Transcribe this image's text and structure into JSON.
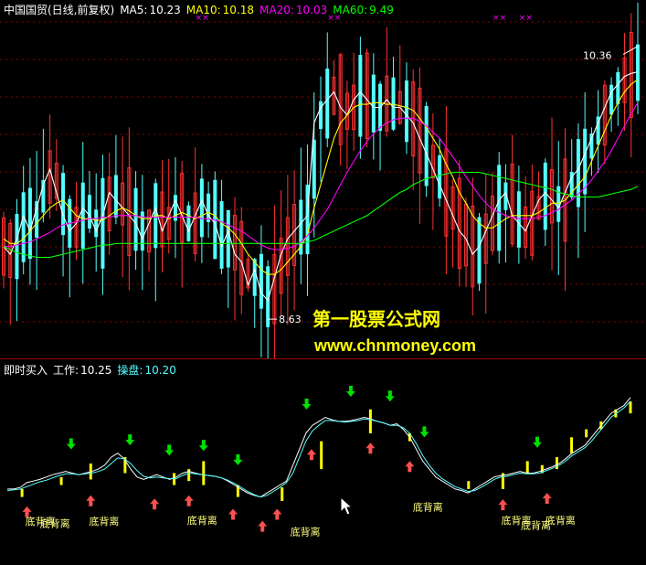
{
  "header": {
    "stock_name": "中国国贸(日线,前复权)",
    "ma5_label": "MA5:",
    "ma5_value": "10.23",
    "ma10_label": "MA10:",
    "ma10_value": "10.18",
    "ma20_label": "MA20:",
    "ma20_value": "10.03",
    "ma60_label": "MA60:",
    "ma60_value": "9.49"
  },
  "sub_header": {
    "indicator_name": "即时买入",
    "work_label": "工作:",
    "work_value": "10.25",
    "trade_label": "操盘:",
    "trade_value": "10.20"
  },
  "watermark": {
    "line1": "第一股票公式网",
    "line2": "www.chnmoney.com"
  },
  "colors": {
    "up": "#ff3232",
    "down": "#54ffff",
    "ma5": "#ffffff",
    "ma10": "#ffff00",
    "ma20": "#ff00ff",
    "ma60": "#00ff00",
    "grid": "#8b0000",
    "work": "#ffffff",
    "trade": "#54ffff",
    "bar": "#ffff00",
    "buy_arrow": "#ff5050",
    "sell_arrow": "#00e000"
  },
  "chart_data": [
    {
      "type": "candlestick",
      "title": "中国国贸(日线,前复权)",
      "ylim": [
        8.4,
        10.6
      ],
      "annotations": [
        {
          "text": "10.36",
          "kind": "high",
          "x": 96,
          "y": 10.36
        },
        {
          "text": "8.63",
          "kind": "low",
          "x": 40,
          "y": 8.63
        }
      ],
      "top_markers": {
        "text": "××",
        "x": [
          29,
          49,
          74,
          78
        ]
      },
      "series": [
        {
          "name": "MA5",
          "values": [
            9.1,
            9.05,
            9.15,
            9.3,
            9.2,
            9.35,
            9.5,
            9.6,
            9.45,
            9.3,
            9.2,
            9.25,
            9.35,
            9.3,
            9.2,
            9.3,
            9.45,
            9.4,
            9.35,
            9.3,
            9.25,
            9.15,
            9.25,
            9.35,
            9.2,
            9.3,
            9.4,
            9.3,
            9.2,
            9.3,
            9.4,
            9.3,
            9.25,
            9.1,
            9.2,
            9.05,
            9.0,
            8.85,
            8.95,
            8.8,
            8.75,
            8.9,
            9.05,
            9.15,
            9.2,
            9.25,
            9.3,
            9.9,
            10.0,
            10.05,
            10.1,
            10.0,
            9.95,
            10.05,
            10.1,
            10.05,
            10.0,
            10.0,
            10.05,
            10.0,
            10.0,
            9.95,
            9.9,
            9.8,
            9.7,
            9.6,
            9.5,
            9.4,
            9.3,
            9.2,
            9.15,
            9.05,
            9.1,
            9.2,
            9.3,
            9.4,
            9.45,
            9.3,
            9.25,
            9.2,
            9.3,
            9.4,
            9.45,
            9.4,
            9.35,
            9.45,
            9.55,
            9.6,
            9.7,
            9.8,
            9.9,
            10.0,
            10.1,
            10.15,
            10.2,
            10.22,
            10.23
          ]
        },
        {
          "name": "MA10",
          "values": [
            9.15,
            9.12,
            9.12,
            9.15,
            9.2,
            9.25,
            9.3,
            9.35,
            9.38,
            9.4,
            9.35,
            9.3,
            9.28,
            9.28,
            9.27,
            9.27,
            9.3,
            9.33,
            9.35,
            9.33,
            9.3,
            9.28,
            9.28,
            9.3,
            9.3,
            9.28,
            9.3,
            9.32,
            9.3,
            9.28,
            9.3,
            9.32,
            9.3,
            9.25,
            9.22,
            9.18,
            9.12,
            9.05,
            9.0,
            8.95,
            8.92,
            8.92,
            8.95,
            9.0,
            9.05,
            9.1,
            9.18,
            9.35,
            9.5,
            9.65,
            9.8,
            9.9,
            9.95,
            10.0,
            10.02,
            10.02,
            10.03,
            10.03,
            10.02,
            10.02,
            10.01,
            10.0,
            9.98,
            9.93,
            9.87,
            9.8,
            9.73,
            9.63,
            9.55,
            9.45,
            9.38,
            9.3,
            9.25,
            9.22,
            9.22,
            9.25,
            9.28,
            9.3,
            9.3,
            9.3,
            9.3,
            9.32,
            9.35,
            9.38,
            9.38,
            9.4,
            9.45,
            9.5,
            9.55,
            9.65,
            9.75,
            9.85,
            9.95,
            10.03,
            10.1,
            10.15,
            10.18
          ]
        },
        {
          "name": "MA20",
          "values": [
            9.1,
            9.1,
            9.11,
            9.12,
            9.13,
            9.15,
            9.17,
            9.19,
            9.22,
            9.24,
            9.25,
            9.26,
            9.27,
            9.28,
            9.28,
            9.29,
            9.29,
            9.3,
            9.3,
            9.3,
            9.3,
            9.29,
            9.29,
            9.29,
            9.29,
            9.29,
            9.29,
            9.29,
            9.29,
            9.29,
            9.28,
            9.28,
            9.27,
            9.26,
            9.24,
            9.22,
            9.2,
            9.17,
            9.14,
            9.11,
            9.09,
            9.08,
            9.08,
            9.09,
            9.1,
            9.13,
            9.17,
            9.22,
            9.28,
            9.34,
            9.42,
            9.5,
            9.58,
            9.65,
            9.72,
            9.78,
            9.83,
            9.87,
            9.9,
            9.92,
            9.93,
            9.93,
            9.93,
            9.91,
            9.88,
            9.84,
            9.8,
            9.74,
            9.68,
            9.62,
            9.55,
            9.49,
            9.43,
            9.38,
            9.34,
            9.32,
            9.3,
            9.29,
            9.28,
            9.28,
            9.28,
            9.29,
            9.3,
            9.32,
            9.34,
            9.37,
            9.4,
            9.44,
            9.48,
            9.53,
            9.59,
            9.65,
            9.72,
            9.8,
            9.88,
            9.96,
            10.03
          ]
        },
        {
          "name": "MA60",
          "values": [
            9.1,
            9.08,
            9.06,
            9.05,
            9.04,
            9.03,
            9.03,
            9.03,
            9.04,
            9.05,
            9.06,
            9.07,
            9.08,
            9.09,
            9.1,
            9.11,
            9.11,
            9.12,
            9.12,
            9.12,
            9.12,
            9.12,
            9.12,
            9.12,
            9.12,
            9.12,
            9.12,
            9.12,
            9.12,
            9.12,
            9.12,
            9.12,
            9.12,
            9.12,
            9.12,
            9.12,
            9.12,
            9.12,
            9.12,
            9.12,
            9.12,
            9.12,
            9.12,
            9.12,
            9.12,
            9.12,
            9.13,
            9.14,
            9.16,
            9.18,
            9.2,
            9.22,
            9.24,
            9.26,
            9.28,
            9.3,
            9.33,
            9.36,
            9.39,
            9.42,
            9.45,
            9.47,
            9.5,
            9.52,
            9.54,
            9.55,
            9.56,
            9.57,
            9.58,
            9.58,
            9.58,
            9.58,
            9.58,
            9.57,
            9.56,
            9.55,
            9.54,
            9.53,
            9.52,
            9.51,
            9.5,
            9.49,
            9.48,
            9.47,
            9.45,
            9.44,
            9.43,
            9.42,
            9.42,
            9.42,
            9.42,
            9.43,
            9.44,
            9.45,
            9.46,
            9.47,
            9.49
          ]
        }
      ]
    },
    {
      "type": "line",
      "title": "即时买入",
      "ylim": [
        8.8,
        10.5
      ],
      "series": [
        {
          "name": "工作",
          "values": [
            9.1,
            9.1,
            9.12,
            9.18,
            9.2,
            9.22,
            9.25,
            9.28,
            9.3,
            9.32,
            9.3,
            9.28,
            9.3,
            9.32,
            9.35,
            9.4,
            9.5,
            9.55,
            9.48,
            9.35,
            9.25,
            9.22,
            9.25,
            9.28,
            9.25,
            9.22,
            9.25,
            9.3,
            9.32,
            9.3,
            9.28,
            9.27,
            9.26,
            9.24,
            9.2,
            9.15,
            9.1,
            9.05,
            9.02,
            9.0,
            9.05,
            9.1,
            9.15,
            9.2,
            9.4,
            9.6,
            9.8,
            9.9,
            9.95,
            10.0,
            9.97,
            9.95,
            9.95,
            9.96,
            9.98,
            10.0,
            9.98,
            9.95,
            9.93,
            9.9,
            9.92,
            9.85,
            9.75,
            9.6,
            9.45,
            9.35,
            9.25,
            9.2,
            9.15,
            9.1,
            9.08,
            9.05,
            9.1,
            9.15,
            9.2,
            9.25,
            9.27,
            9.28,
            9.3,
            9.32,
            9.3,
            9.3,
            9.32,
            9.35,
            9.38,
            9.42,
            9.48,
            9.55,
            9.6,
            9.65,
            9.75,
            9.85,
            9.95,
            10.05,
            10.1,
            10.15,
            10.25
          ]
        },
        {
          "name": "操盘",
          "values": [
            9.08,
            9.09,
            9.1,
            9.13,
            9.16,
            9.19,
            9.21,
            9.24,
            9.27,
            9.29,
            9.29,
            9.28,
            9.29,
            9.3,
            9.32,
            9.35,
            9.42,
            9.49,
            9.48,
            9.42,
            9.33,
            9.26,
            9.24,
            9.25,
            9.24,
            9.23,
            9.23,
            9.27,
            9.3,
            9.29,
            9.28,
            9.27,
            9.26,
            9.24,
            9.21,
            9.17,
            9.12,
            9.07,
            9.03,
            9.0,
            9.02,
            9.07,
            9.12,
            9.18,
            9.3,
            9.5,
            9.7,
            9.83,
            9.9,
            9.96,
            9.96,
            9.95,
            9.94,
            9.95,
            9.96,
            9.98,
            9.97,
            9.95,
            9.93,
            9.9,
            9.9,
            9.87,
            9.8,
            9.67,
            9.52,
            9.4,
            9.3,
            9.23,
            9.18,
            9.13,
            9.1,
            9.07,
            9.08,
            9.12,
            9.17,
            9.22,
            9.25,
            9.26,
            9.28,
            9.3,
            9.29,
            9.29,
            9.3,
            9.33,
            9.36,
            9.4,
            9.45,
            9.52,
            9.57,
            9.62,
            9.7,
            9.8,
            9.9,
            10.0,
            10.06,
            10.12,
            10.2
          ]
        }
      ],
      "signal_bars": [
        {
          "x": 3,
          "from": 9.0,
          "to": 9.1
        },
        {
          "x": 11,
          "from": 9.15,
          "to": 9.25
        },
        {
          "x": 17,
          "from": 9.22,
          "to": 9.42
        },
        {
          "x": 24,
          "from": 9.3,
          "to": 9.5
        },
        {
          "x": 34,
          "from": 9.15,
          "to": 9.3
        },
        {
          "x": 37,
          "from": 9.2,
          "to": 9.35
        },
        {
          "x": 40,
          "from": 9.15,
          "to": 9.45
        },
        {
          "x": 47,
          "from": 9.0,
          "to": 9.15
        },
        {
          "x": 56,
          "from": 8.95,
          "to": 9.12
        },
        {
          "x": 64,
          "from": 9.35,
          "to": 9.7
        },
        {
          "x": 74,
          "from": 9.8,
          "to": 10.1
        },
        {
          "x": 82,
          "from": 9.7,
          "to": 9.8
        },
        {
          "x": 94,
          "from": 9.1,
          "to": 9.2
        },
        {
          "x": 101,
          "from": 9.1,
          "to": 9.3
        },
        {
          "x": 106,
          "from": 9.3,
          "to": 9.45
        },
        {
          "x": 109,
          "from": 9.3,
          "to": 9.4
        },
        {
          "x": 112,
          "from": 9.35,
          "to": 9.5
        },
        {
          "x": 115,
          "from": 9.55,
          "to": 9.75
        },
        {
          "x": 118,
          "from": 9.75,
          "to": 9.85
        },
        {
          "x": 121,
          "from": 9.85,
          "to": 9.95
        },
        {
          "x": 124,
          "from": 10.0,
          "to": 10.1
        },
        {
          "x": 127,
          "from": 10.05,
          "to": 10.2
        }
      ],
      "buy_arrows_x": [
        4,
        17,
        30,
        37,
        46,
        52,
        55,
        62,
        74,
        82,
        101,
        110
      ],
      "sell_arrows_x": [
        13,
        25,
        33,
        40,
        47,
        61,
        70,
        78,
        85,
        108
      ],
      "annotations": [
        {
          "text": "底背离",
          "x": 7,
          "y": 8.65
        },
        {
          "text": "底背离",
          "x": 10,
          "y": 8.62
        },
        {
          "text": "底背离",
          "x": 20,
          "y": 8.65
        },
        {
          "text": "底背离",
          "x": 40,
          "y": 8.66
        },
        {
          "text": "底背离",
          "x": 61,
          "y": 8.52
        },
        {
          "text": "底背离",
          "x": 86,
          "y": 8.83
        },
        {
          "text": "底背离",
          "x": 104,
          "y": 8.66
        },
        {
          "text": "底背离",
          "x": 113,
          "y": 8.66
        },
        {
          "text": "底背离",
          "x": 108,
          "y": 8.6
        }
      ]
    }
  ]
}
